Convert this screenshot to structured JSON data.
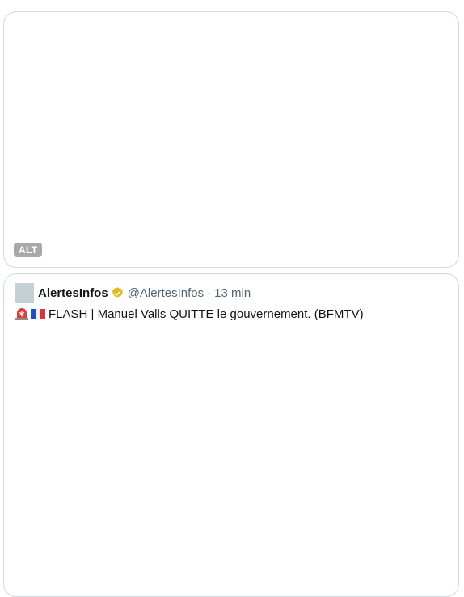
{
  "media": {
    "alt_label": "ALT"
  },
  "quote": {
    "display_name": "AlertesInfos",
    "handle": "@AlertesInfos",
    "separator": "·",
    "time": "13 min",
    "text": "FLASH | Manuel Valls QUITTE le gouvernement. (BFMTV)",
    "emojis": [
      "rotating-light-emoji",
      "france-flag-emoji"
    ]
  },
  "colors": {
    "border": "#cfd9de",
    "text_primary": "#0f1419",
    "text_secondary": "#536471",
    "verified_gold": "#e2b719",
    "alt_badge_bg": "#a9a9a9",
    "avatar_placeholder": "#c4cfd6"
  }
}
